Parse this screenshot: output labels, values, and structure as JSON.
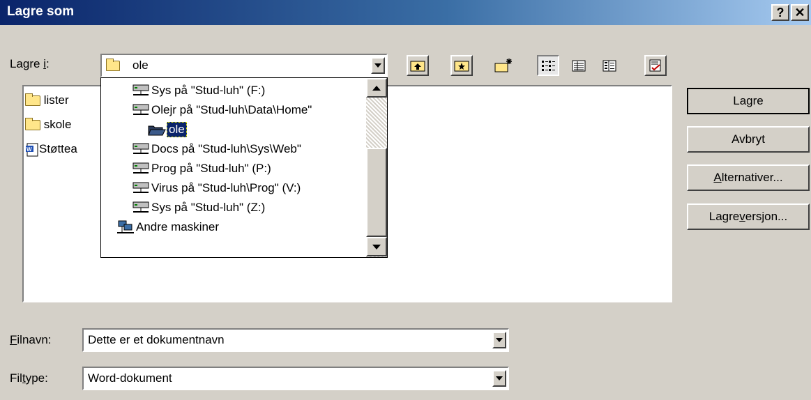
{
  "window": {
    "title": "Lagre som",
    "help_button": "?",
    "close_button": "✕"
  },
  "save_in": {
    "label_prefix": "Lagre ",
    "label_accel": "i",
    "label_suffix": ":",
    "value": "ole"
  },
  "dropdown": {
    "items": [
      {
        "label": "Sys på \"Stud-luh\" (F:)",
        "icon": "network-drive-icon"
      },
      {
        "label": "Olejr på \"Stud-luh\\Data\\Home\"",
        "icon": "network-drive-icon"
      },
      {
        "label": "ole",
        "icon": "open-folder-icon",
        "selected": true
      },
      {
        "label": "Docs på \"Stud-luh\\Sys\\Web\"",
        "icon": "network-drive-icon"
      },
      {
        "label": "Prog på \"Stud-luh\" (P:)",
        "icon": "network-drive-icon"
      },
      {
        "label": "Virus på \"Stud-luh\\Prog\" (V:)",
        "icon": "network-drive-icon"
      },
      {
        "label": "Sys på \"Stud-luh\" (Z:)",
        "icon": "network-drive-icon"
      },
      {
        "label": "Andre maskiner",
        "icon": "network-neighborhood-icon"
      }
    ]
  },
  "files": [
    {
      "label": "lister",
      "icon": "folder-icon"
    },
    {
      "label": "skole",
      "icon": "folder-icon"
    },
    {
      "label": "Støttea",
      "icon": "word-document-icon"
    }
  ],
  "buttons": {
    "save": {
      "prefix": "La",
      "accel": "g",
      "suffix": "re"
    },
    "cancel": {
      "label": "Avbryt"
    },
    "options": {
      "accel": "A",
      "suffix": "lternativer..."
    },
    "save_version": {
      "prefix": "Lagre ",
      "accel": "v",
      "suffix": "ersjon..."
    }
  },
  "filename": {
    "label_accel": "F",
    "label_suffix": "ilnavn:",
    "value": "Dette er et dokumentnavn"
  },
  "filetype": {
    "label_prefix": "Fil",
    "label_accel": "t",
    "label_suffix": "ype:",
    "value": "Word-dokument"
  },
  "colors": {
    "titlebar_start": "#0a246a",
    "titlebar_end": "#a6caf0",
    "face": "#d4d0c8",
    "selection": "#0a246a"
  }
}
